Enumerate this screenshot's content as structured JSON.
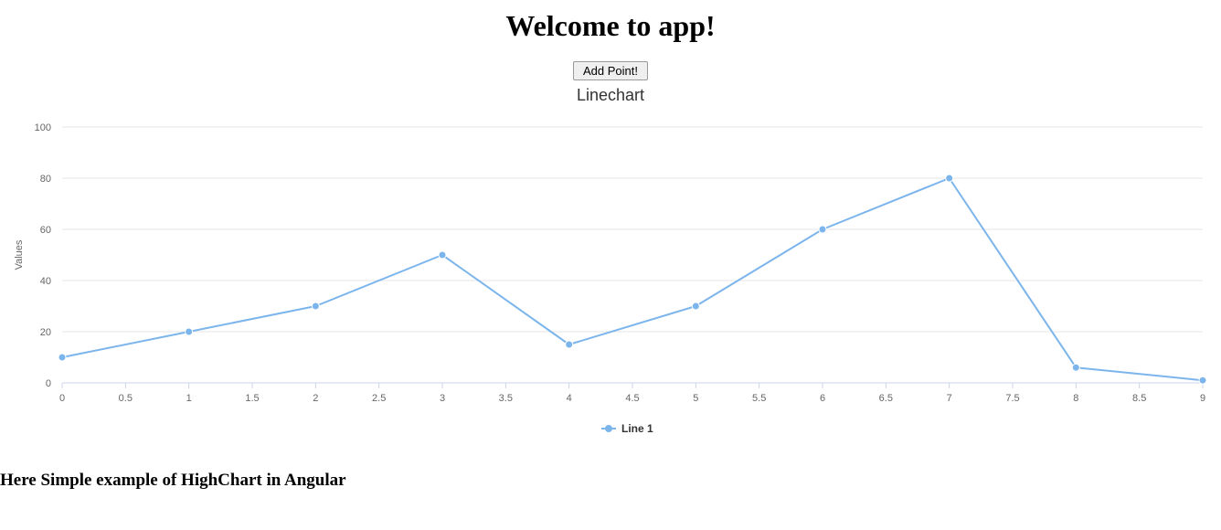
{
  "page": {
    "title": "Welcome to app!",
    "add_point_label": "Add Point!",
    "caption": "Here Simple example of HighChart in Angular"
  },
  "chart_data": {
    "type": "line",
    "title": "Linechart",
    "xlabel": "",
    "ylabel": "Values",
    "x": [
      0,
      1,
      2,
      3,
      4,
      5,
      6,
      7,
      8,
      9
    ],
    "x_ticks": [
      0,
      0.5,
      1,
      1.5,
      2,
      2.5,
      3,
      3.5,
      4,
      4.5,
      5,
      5.5,
      6,
      6.5,
      7,
      7.5,
      8,
      8.5,
      9
    ],
    "y_ticks": [
      0,
      20,
      40,
      60,
      80,
      100
    ],
    "ylim": [
      0,
      100
    ],
    "series": [
      {
        "name": "Line 1",
        "values": [
          10,
          20,
          30,
          50,
          15,
          30,
          60,
          80,
          6,
          1
        ]
      }
    ],
    "legend_position": "bottom",
    "grid": true
  }
}
